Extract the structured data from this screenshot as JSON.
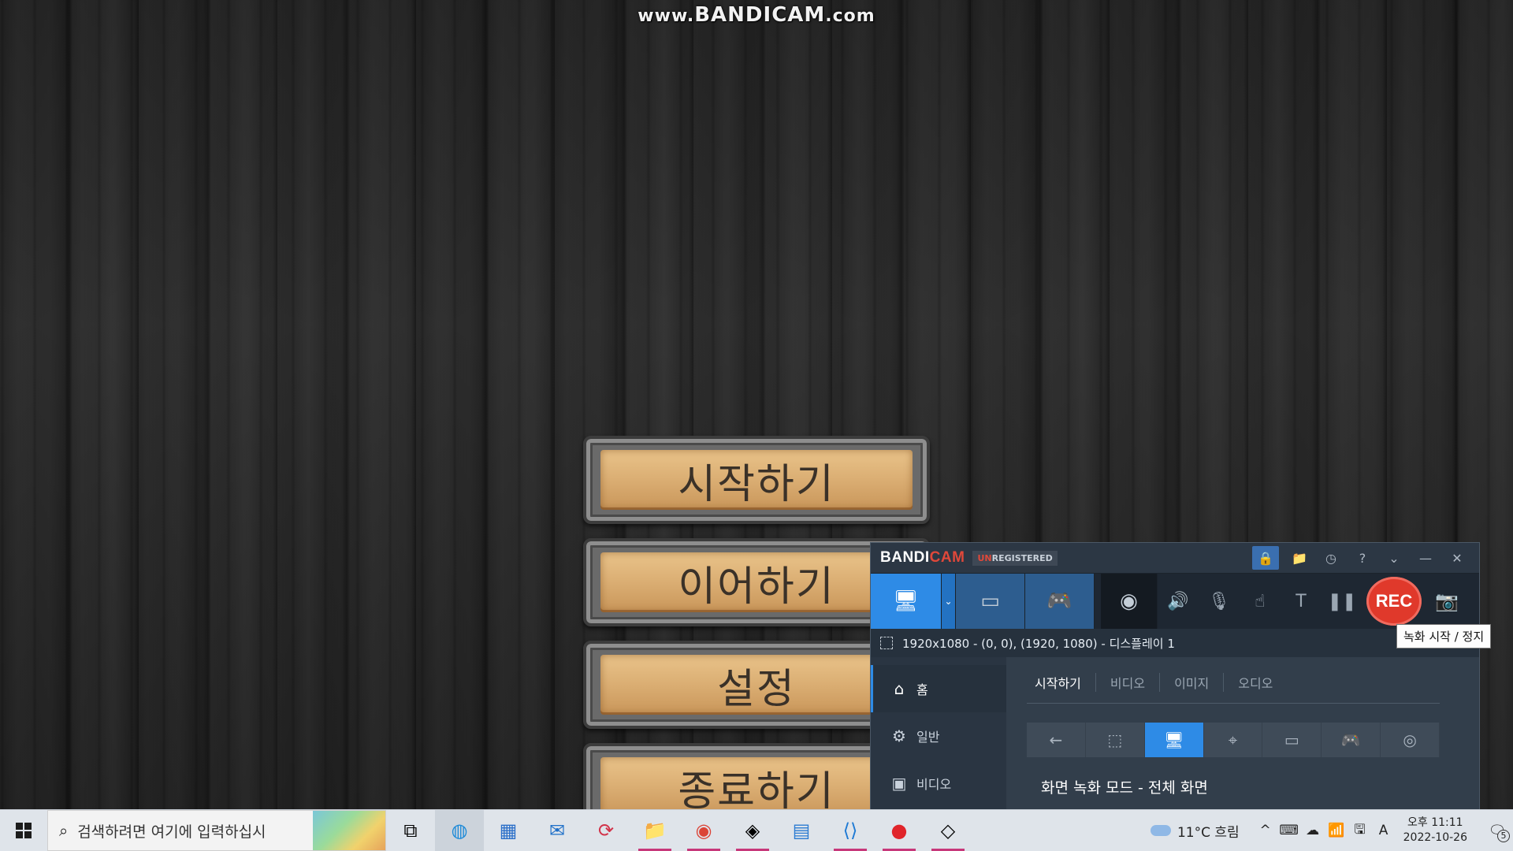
{
  "watermark": {
    "prefix": "www.",
    "brand": "BANDICAM",
    "suffix": ".com"
  },
  "menu": [
    {
      "label": "시작하기"
    },
    {
      "label": "이어하기"
    },
    {
      "label": "설정"
    },
    {
      "label": "종료하기"
    }
  ],
  "bandicam": {
    "logo_bandi": "BANDI",
    "logo_cam": "CAM",
    "unregistered_un": "UN",
    "unregistered_rest": "REGISTERED",
    "title_icons": [
      "lock-icon",
      "folder-icon",
      "clock-icon",
      "help-icon",
      "collapse-icon",
      "minimize-icon",
      "close-icon"
    ],
    "title_glyphs": {
      "lock": "🔒",
      "folder": "📁",
      "clock": "◷",
      "help": "?",
      "collapse": "⌄",
      "minimize": "—",
      "close": "✕"
    },
    "toolbar": {
      "screen_glyph": "🖥",
      "dropdown_glyph": "⌄",
      "hdmi_glyph": "▭",
      "game_glyph": "🎮",
      "webcam_glyph": "◉",
      "speaker_glyph": "🔊",
      "mic_glyph": "🎙",
      "cursor_glyph": "☝",
      "text_glyph": "T",
      "pause_glyph": "❚❚",
      "rec_label": "REC",
      "camera_glyph": "📷"
    },
    "tooltip": "녹화 시작 / 정지",
    "info": "1920x1080 - (0, 0), (1920, 1080) - 디스플레이 1",
    "sidebar": [
      {
        "icon": "home-icon",
        "glyph": "⌂",
        "label": "홈",
        "active": true
      },
      {
        "icon": "gear-icon",
        "glyph": "⚙",
        "label": "일반",
        "active": false
      },
      {
        "icon": "video-settings-icon",
        "glyph": "▣",
        "label": "비디오",
        "active": false
      }
    ],
    "tabs": [
      "시작하기",
      "비디오",
      "이미지",
      "오디오"
    ],
    "modes": [
      {
        "icon": "back-arrow-icon",
        "glyph": "←"
      },
      {
        "icon": "rect-area-icon",
        "glyph": "⬚"
      },
      {
        "icon": "fullscreen-icon",
        "glyph": "🖥"
      },
      {
        "icon": "cursor-area-icon",
        "glyph": "⌖"
      },
      {
        "icon": "hdmi-icon",
        "glyph": "▭"
      },
      {
        "icon": "gamepad-icon",
        "glyph": "🎮"
      },
      {
        "icon": "audio-only-icon",
        "glyph": "◎"
      }
    ],
    "active_mode_index": 2,
    "mode_caption": "화면 녹화 모드 - 전체 화면"
  },
  "taskbar": {
    "search_placeholder": "검색하려면 여기에 입력하십시",
    "apps": [
      {
        "name": "task-view-icon",
        "glyph": "⧉",
        "open": false
      },
      {
        "name": "edge-icon",
        "glyph": "◍",
        "open": false,
        "focus": true
      },
      {
        "name": "store-icon",
        "glyph": "▦",
        "open": false
      },
      {
        "name": "mail-icon",
        "glyph": "✉",
        "open": false
      },
      {
        "name": "sync-app-icon",
        "glyph": "⟳",
        "open": false
      },
      {
        "name": "file-explorer-icon",
        "glyph": "📁",
        "open": true
      },
      {
        "name": "chrome-icon",
        "glyph": "◉",
        "open": true
      },
      {
        "name": "unity-hub-icon",
        "glyph": "◈",
        "open": true
      },
      {
        "name": "notepad-app-icon",
        "glyph": "▤",
        "open": false
      },
      {
        "name": "vscode-icon",
        "glyph": "⟨⟩",
        "open": true
      },
      {
        "name": "bandicam-icon",
        "glyph": "●",
        "open": true
      },
      {
        "name": "unity-icon",
        "glyph": "◇",
        "open": true
      }
    ],
    "weather": "11°C  흐림",
    "tray_icons": [
      "^",
      "⌨",
      "☁",
      "📶",
      "🖫",
      "A"
    ],
    "clock_time": "오후 11:11",
    "clock_date": "2022-10-26",
    "notification_count": "5"
  },
  "colors": {
    "accent": "#2e8be6",
    "rec": "#e0392b",
    "wood": "#dcb075"
  }
}
